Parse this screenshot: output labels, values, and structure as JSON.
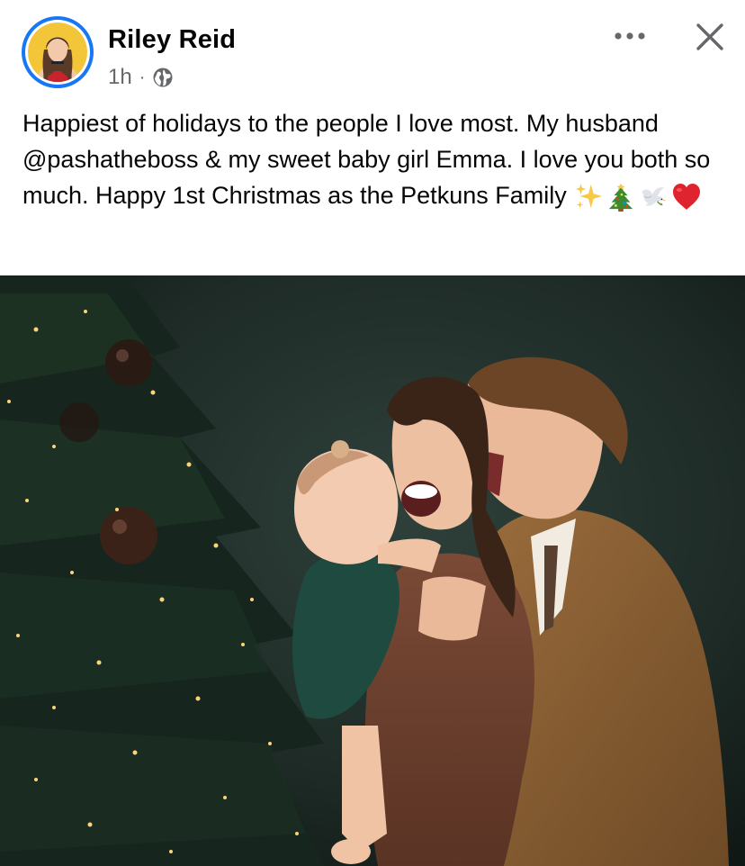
{
  "post": {
    "author": "Riley Reid",
    "time": "1h",
    "separator": "·",
    "caption": "Happiest of holidays to the people I love most. My husband @pashatheboss & my sweet baby girl Emma. I love you both so much. Happy 1st Christmas as the Petkuns Family",
    "caption_emojis": [
      "sparkles-icon",
      "christmas-tree-icon",
      "dove-icon",
      "red-heart-icon"
    ],
    "privacy_icon": "globe-icon",
    "more_icon": "more-options-icon",
    "close_icon": "close-icon"
  },
  "colors": {
    "avatar_ring": "#1877f2",
    "meta_text": "#65676b",
    "text": "#050505",
    "photo_backdrop": "#1e2b27"
  }
}
